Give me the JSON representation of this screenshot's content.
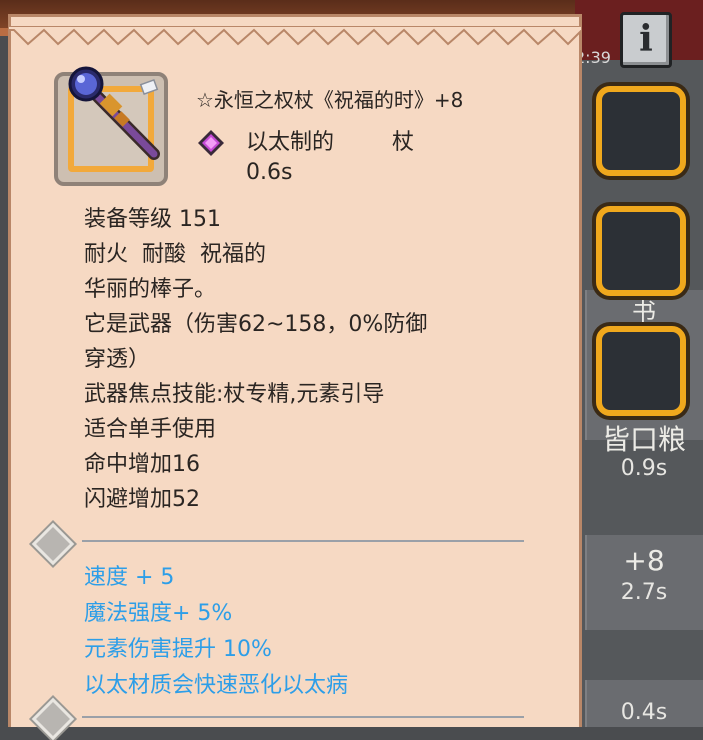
{
  "item": {
    "title": "☆永恒之权杖《祝福的时》+8",
    "material": "以太制的",
    "weapon_type": "杖",
    "speed": "0.6s",
    "icon": "staff-icon",
    "gem_icon": "purple-gem-icon",
    "stats": [
      "装备等级 151",
      "耐火  耐酸  祝福的",
      "华丽的棒子。",
      "它是武器（伤害62~158，0%防御",
      "穿透）",
      "武器焦点技能:杖专精,元素引导",
      "适合单手使用",
      "命中增加16",
      "闪避增加52"
    ],
    "bonuses": [
      "速度 + 5",
      "魔法强度+ 5%",
      "元素伤害提升 10%",
      "以太材质会快速恶化以太病"
    ]
  },
  "background": {
    "clock": "2:39",
    "snippets": [
      "书",
      "皆口粮",
      "0.9s",
      "+8",
      "2.7s",
      "0.4s"
    ]
  },
  "info_button": {
    "label": "i"
  },
  "colors": {
    "panel": "#f6d9c3",
    "bonus_text": "#2d9ee8",
    "slot_border": "#f0a81d"
  }
}
